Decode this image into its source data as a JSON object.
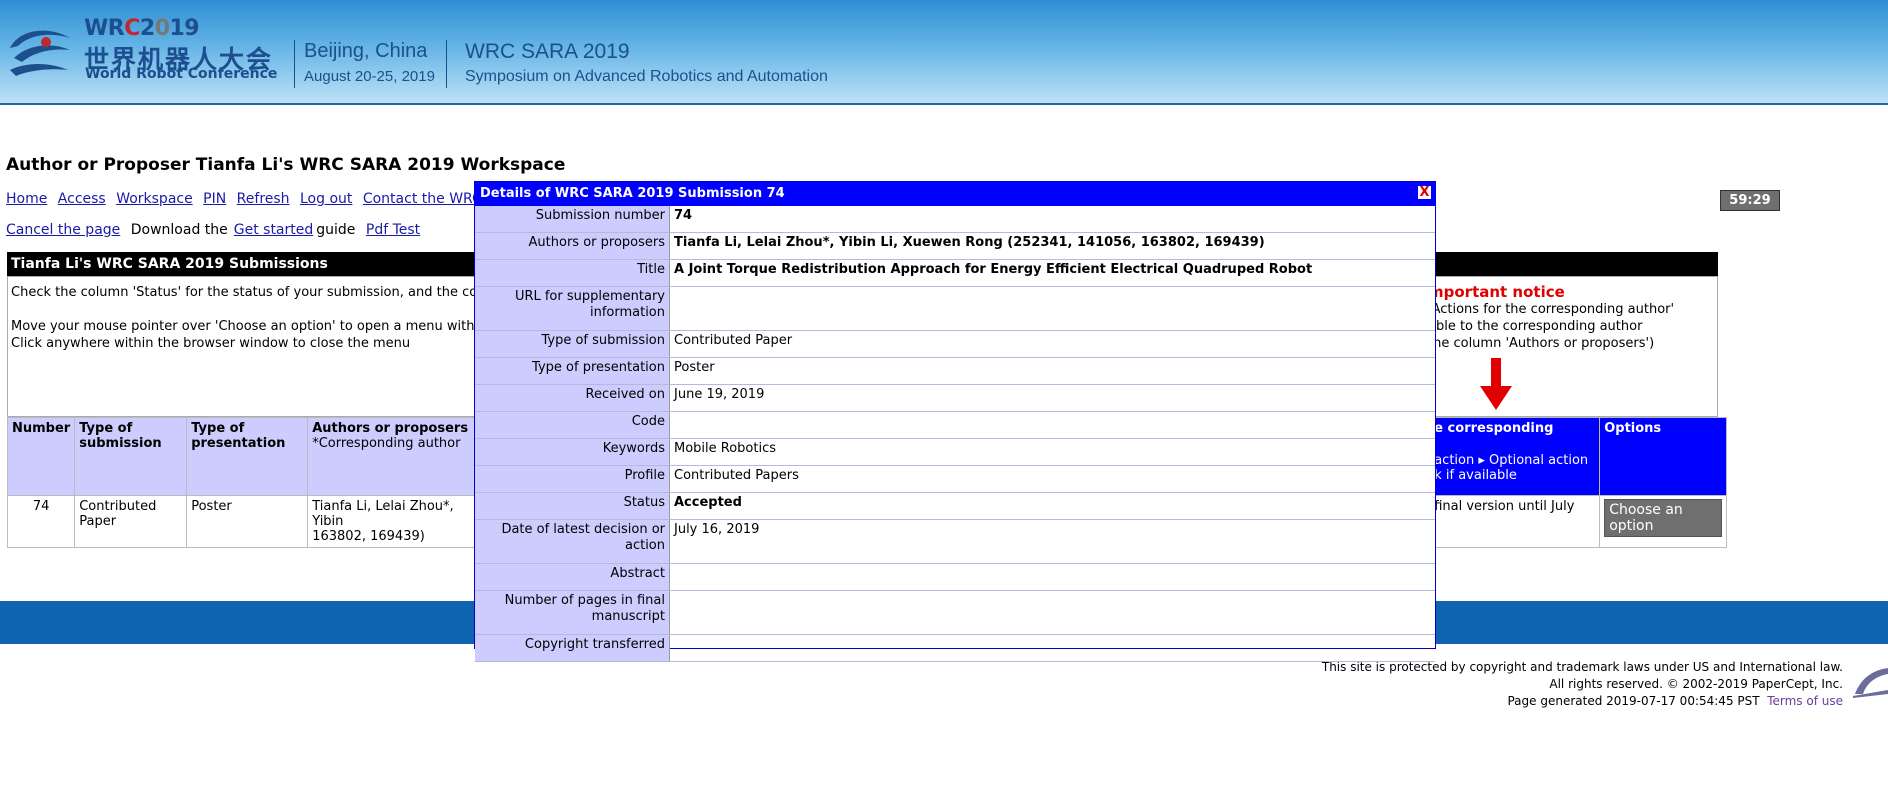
{
  "header": {
    "logo_year_w": "WR",
    "logo_year_c": "C",
    "logo_year_2": "2",
    "logo_year_0": "0",
    "logo_year_19": "19",
    "logo_cn": "世界机器人大会",
    "logo_en": "World Robot Conference",
    "city": "Beijing, China",
    "dates": "August 20-25, 2019",
    "conf_name": "WRC SARA 2019",
    "conf_full": "Symposium on Advanced Robotics and Automation"
  },
  "workspace": {
    "title": "Author or Proposer Tianfa Li's WRC SARA 2019 Workspace",
    "nav": [
      "Home",
      "Access",
      "Workspace",
      "PIN",
      "Refresh",
      "Log out",
      "Contact the WRC SARA"
    ],
    "cancel": "Cancel the page",
    "download_prefix": "Download the",
    "get_started": "Get started",
    "guide": "guide",
    "pdf_test": "Pdf Test",
    "timer": "59:29"
  },
  "submissions": {
    "heading": "Tianfa Li's WRC SARA 2019 Submissions",
    "info": [
      "Check the column 'Status' for the status of your submission, and the colu",
      "",
      "Move your mouse pointer over 'Choose an option' to open a menu with",
      "Click anywhere within the browser window to close the menu"
    ],
    "notice_title": "mportant notice",
    "notice_lines": [
      "'Actions for the corresponding author'",
      "able to the corresponding author",
      "the column 'Authors or proposers')"
    ],
    "columns": {
      "number": "Number",
      "type_sub": "Type of submission",
      "type_pres": "Type of presentation",
      "authors": "Authors or proposers",
      "authors_note": "*Corresponding author",
      "corr": "e corresponding",
      "corr_sub1": "action ▸ Optional action",
      "corr_sub2": "k if available",
      "options": "Options"
    },
    "row": {
      "number": "74",
      "type_sub": "Contributed Paper",
      "type_pres": "Poster",
      "authors": "Tianfa Li, Lelai Zhou*, Yibin",
      "authors2": "163802, 169439)",
      "corr": "final version until July",
      "option_btn": "Choose an option"
    }
  },
  "footer": {
    "line1": "This site is protected by copyright and trademark laws under US and International law.",
    "line2": "All rights reserved. © 2002-2019 PaperCept, Inc.",
    "line3": "Page generated 2019-07-17  00:54:45 PST",
    "terms": "Terms of use"
  },
  "modal": {
    "title": "Details of WRC SARA 2019 Submission 74",
    "close": "X",
    "rows": [
      {
        "label": "Submission number",
        "value": "74"
      },
      {
        "label": "Authors or proposers",
        "value": "Tianfa Li, Lelai Zhou*, Yibin Li, Xuewen Rong (252341, 141056, 163802, 169439)"
      },
      {
        "label": "Title",
        "value": "A Joint Torque Redistribution Approach for Energy Efficient Electrical Quadruped Robot"
      },
      {
        "label": "URL for supplementary information",
        "value": ""
      },
      {
        "label": "Type of submission",
        "value": "Contributed Paper"
      },
      {
        "label": "Type of presentation",
        "value": "Poster"
      },
      {
        "label": "Received on",
        "value": "June 19, 2019"
      },
      {
        "label": "Code",
        "value": ""
      },
      {
        "label": "Keywords",
        "value": "Mobile Robotics"
      },
      {
        "label": "Profile",
        "value": "Contributed Papers"
      },
      {
        "label": "Status",
        "value": "Accepted"
      },
      {
        "label": "Date of latest decision or action",
        "value": "July 16, 2019"
      },
      {
        "label": "Abstract",
        "value": ""
      },
      {
        "label": "Number of pages in final manuscript",
        "value": ""
      },
      {
        "label": "Copyright transferred",
        "value": ""
      }
    ]
  },
  "colors": {
    "accent_blue": "#0000ff",
    "label_bg": "#ccccff",
    "link": "#1a1aa8",
    "notice_red": "#e00000"
  }
}
